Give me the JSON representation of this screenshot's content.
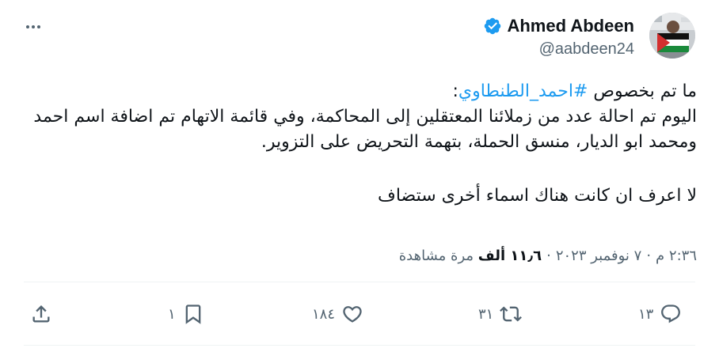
{
  "author": {
    "display_name": "Ahmed Abdeen",
    "handle": "@aabdeen24",
    "verified": true
  },
  "more_icon": "more-horizontal-icon",
  "body": {
    "line1_prefix": "ما تم بخصوص ",
    "hashtag": "#احمد_الطنطاوي",
    "line1_suffix": ":",
    "paragraph1": "اليوم تم احالة عدد من زملائنا المعتقلين إلى المحاكمة، وفي قائمة الاتهام تم اضافة اسم احمد ومحمد ابو الديار، منسق الحملة، بتهمة التحريض على التزوير.",
    "paragraph2": "لا اعرف ان كانت هناك اسماء أخرى ستضاف"
  },
  "meta": {
    "time": "٢:٣٦ م",
    "date": "٧ نوفمبر ٢٠٢٣",
    "views_count": "١١٫٦ ألف",
    "views_label": "مرة مشاهدة"
  },
  "actions": {
    "reply_count": "١٣",
    "repost_count": "٣١",
    "like_count": "١٨٤",
    "bookmark_count": "١"
  },
  "colors": {
    "accent": "#1d9bf0",
    "text": "#0f1419",
    "muted": "#536471",
    "divider": "#eff3f4"
  }
}
